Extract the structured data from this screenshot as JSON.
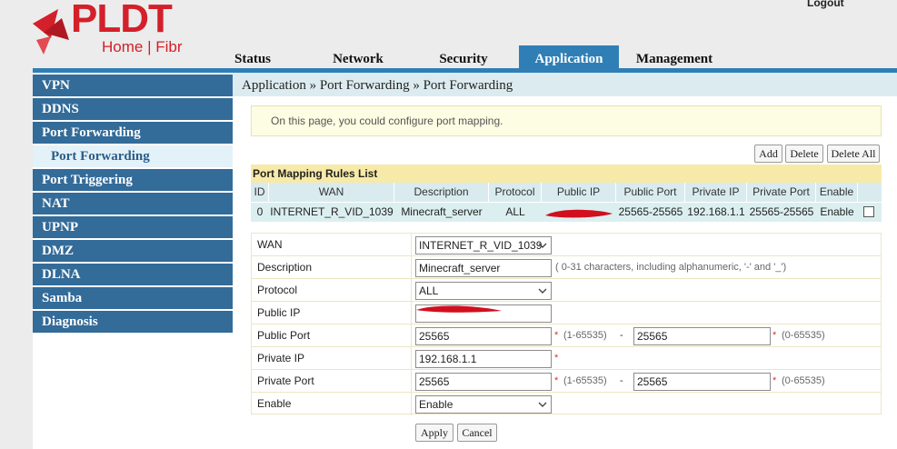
{
  "brand": {
    "name": "PLDT",
    "tagline": "Home | Fibr"
  },
  "header": {
    "logout": "Logout"
  },
  "tabs": [
    {
      "label": "Status",
      "active": false
    },
    {
      "label": "Network",
      "active": false
    },
    {
      "label": "Security",
      "active": false
    },
    {
      "label": "Application",
      "active": true
    },
    {
      "label": "Management",
      "active": false
    }
  ],
  "sidebar": {
    "items": [
      {
        "label": "VPN"
      },
      {
        "label": "DDNS"
      },
      {
        "label": "Port Forwarding"
      },
      {
        "label": "Port Forwarding",
        "selected": true
      },
      {
        "label": "Port Triggering"
      },
      {
        "label": "NAT"
      },
      {
        "label": "UPNP"
      },
      {
        "label": "DMZ"
      },
      {
        "label": "DLNA"
      },
      {
        "label": "Samba"
      },
      {
        "label": "Diagnosis"
      }
    ]
  },
  "breadcrumb": "Application » Port Forwarding » Port Forwarding",
  "info": "On this page, you could configure port mapping.",
  "actions": {
    "add": "Add",
    "delete": "Delete",
    "delete_all": "Delete All"
  },
  "rules": {
    "title": "Port Mapping Rules List",
    "columns": [
      "ID",
      "WAN",
      "Description",
      "Protocol",
      "Public IP",
      "Public Port",
      "Private IP",
      "Private Port",
      "Enable"
    ],
    "rows": [
      {
        "id": "0",
        "wan": "INTERNET_R_VID_1039",
        "description": "Minecraft_server",
        "protocol": "ALL",
        "public_ip": "",
        "public_port": "25565-25565",
        "private_ip": "192.168.1.1",
        "private_port": "25565-25565",
        "enable": "Enable",
        "selected": false
      }
    ]
  },
  "form": {
    "wan": {
      "label": "WAN",
      "value": "INTERNET_R_VID_1039"
    },
    "description": {
      "label": "Description",
      "value": "Minecraft_server",
      "hint": "( 0-31 characters, including alphanumeric, '-' and '_')"
    },
    "protocol": {
      "label": "Protocol",
      "value": "ALL"
    },
    "public_ip": {
      "label": "Public IP",
      "value": ""
    },
    "public_port": {
      "label": "Public Port",
      "start": "25565",
      "end": "25565",
      "range_start": "(1-65535)",
      "dash": "-",
      "range_end": "(0-65535)"
    },
    "private_ip": {
      "label": "Private IP",
      "value": "192.168.1.1"
    },
    "private_port": {
      "label": "Private Port",
      "start": "25565",
      "end": "25565",
      "range_start": "(1-65535)",
      "dash": "-",
      "range_end": "(0-65535)"
    },
    "enable": {
      "label": "Enable",
      "value": "Enable"
    },
    "required_mark": "*"
  },
  "buttons": {
    "apply": "Apply",
    "cancel": "Cancel"
  },
  "colors": {
    "nav_blue": "#2f7fb6",
    "sidebar_blue": "#336b99",
    "brand_red": "#d3202a",
    "redaction": "#d10f1f"
  }
}
